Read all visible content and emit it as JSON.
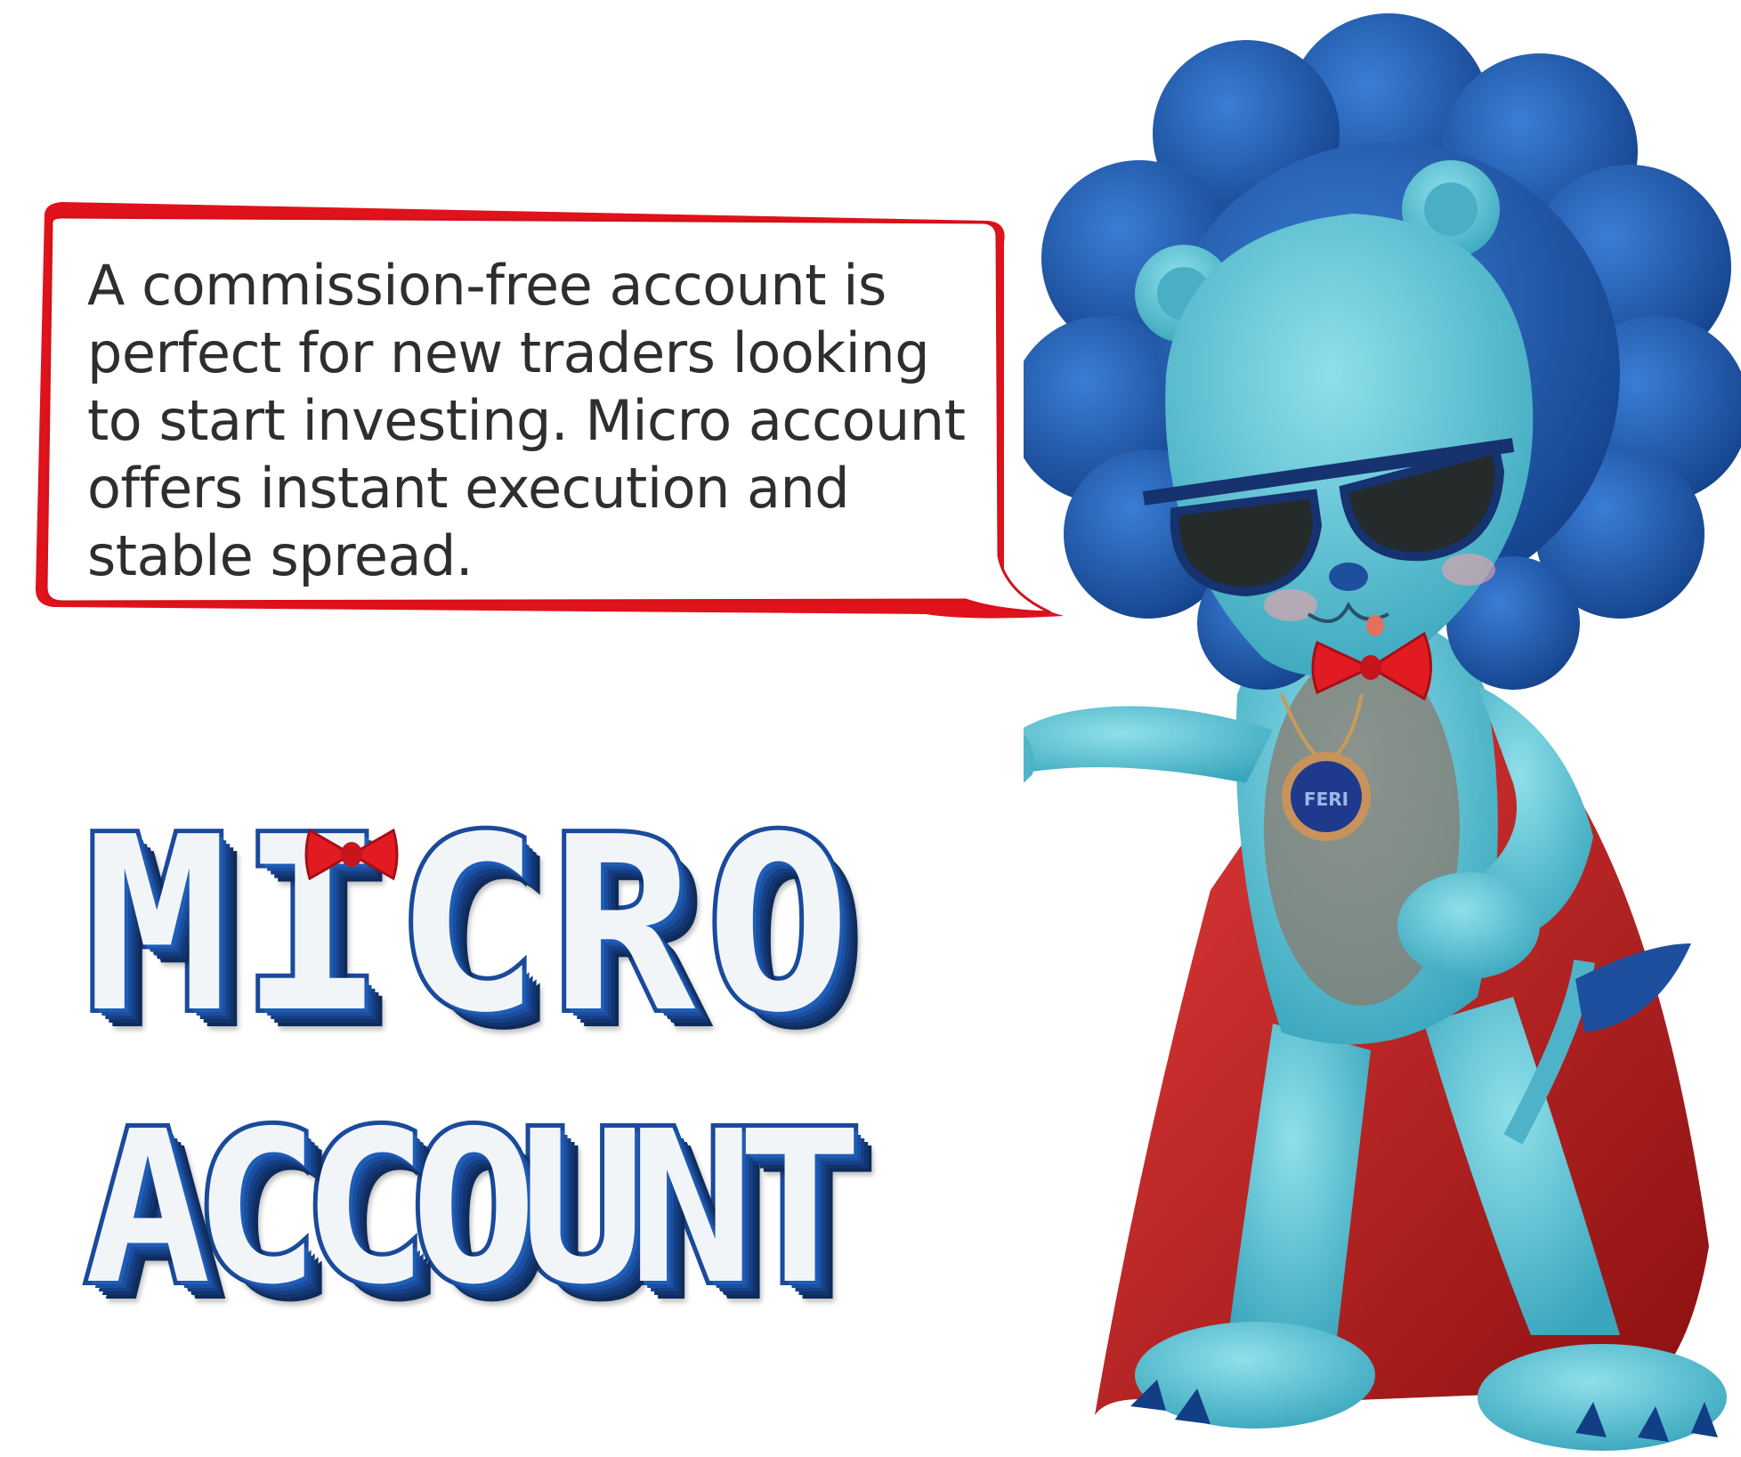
{
  "speech_bubble": {
    "lines": [
      "A commission-free account is",
      "perfect for new traders looking",
      "to start investing. Micro account",
      "offers instant execution and",
      "stable spread."
    ]
  },
  "headline": {
    "line1": "MICRO",
    "line2": "ACCOUNT"
  },
  "mascot": {
    "name": "lion-mascot",
    "pendant_text": "FERI"
  },
  "colors": {
    "bubble_border": "#e0121b",
    "headline_fill": "#f2f5f8",
    "headline_stroke": "#1a4a9b",
    "mane": "#1e4f9f",
    "fur": "#5fc1d2",
    "cape": "#c62828",
    "bowtie": "#e21b23"
  }
}
